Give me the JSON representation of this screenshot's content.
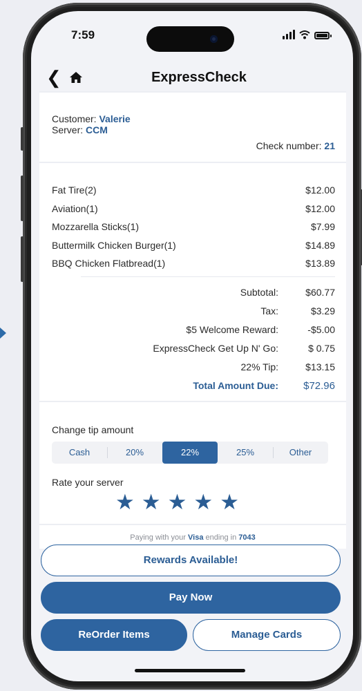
{
  "status": {
    "time": "7:59"
  },
  "nav": {
    "title": "ExpressCheck",
    "back_icon": "chevron-left-icon",
    "home_icon": "home-icon"
  },
  "check": {
    "customer_label": "Customer:",
    "customer_name": "Valerie",
    "server_label": "Server:",
    "server_name": "CCM",
    "check_number_label": "Check number:",
    "check_number": "21"
  },
  "items": [
    {
      "name": "Fat Tire(2)",
      "price": "$12.00"
    },
    {
      "name": "Aviation(1)",
      "price": "$12.00"
    },
    {
      "name": "Mozzarella Sticks(1)",
      "price": "$7.99"
    },
    {
      "name": "Buttermilk Chicken Burger(1)",
      "price": "$14.89"
    },
    {
      "name": "BBQ Chicken Flatbread(1)",
      "price": "$13.89"
    }
  ],
  "totals": [
    {
      "label": "Subtotal:",
      "value": "$60.77"
    },
    {
      "label": "Tax:",
      "value": "$3.29"
    },
    {
      "label": "$5 Welcome Reward:",
      "value": "-$5.00"
    },
    {
      "label": "ExpressCheck Get Up N' Go:",
      "value": "$ 0.75"
    },
    {
      "label": "22% Tip:",
      "value": "$13.15"
    },
    {
      "label": "Total Amount Due:",
      "value": "$72.96"
    }
  ],
  "tip": {
    "label": "Change tip amount",
    "options": [
      "Cash",
      "20%",
      "22%",
      "25%",
      "Other"
    ],
    "selected": "22%"
  },
  "rating": {
    "label": "Rate your server",
    "stars": 5,
    "max": 5
  },
  "payment": {
    "prefix": "Paying with your",
    "card_brand": "Visa",
    "middle": "ending in",
    "last4": "7043"
  },
  "buttons": {
    "rewards": "Rewards Available!",
    "pay_now": "Pay Now",
    "reorder": "ReOrder Items",
    "manage_cards": "Manage Cards"
  },
  "colors": {
    "accent": "#2e64a0",
    "background": "#f2f3f7"
  }
}
